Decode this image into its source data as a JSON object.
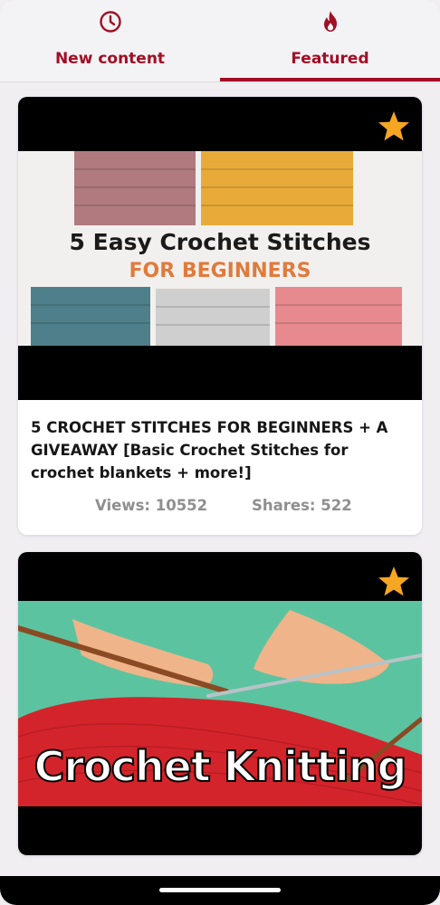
{
  "tabs": [
    {
      "label": "New content",
      "icon": "clock-icon",
      "selected": false
    },
    {
      "label": "Featured",
      "icon": "flame-icon",
      "selected": true
    }
  ],
  "colors": {
    "accent": "#a10e25",
    "star": "#f5a623",
    "stats": "#8f8f8f"
  },
  "cards": [
    {
      "thumbnail_line1": "5 Easy Crochet Stitches",
      "thumbnail_line2": "FOR BEGINNERS",
      "title": "5 CROCHET STITCHES FOR BEGINNERS + A GIVEAWAY [Basic Crochet Stitches for crochet blankets + more!]",
      "views": "Views: 10552",
      "shares": "Shares: 522",
      "starred": true
    },
    {
      "thumbnail_line1": "Crochet Knitting",
      "starred": true
    }
  ]
}
